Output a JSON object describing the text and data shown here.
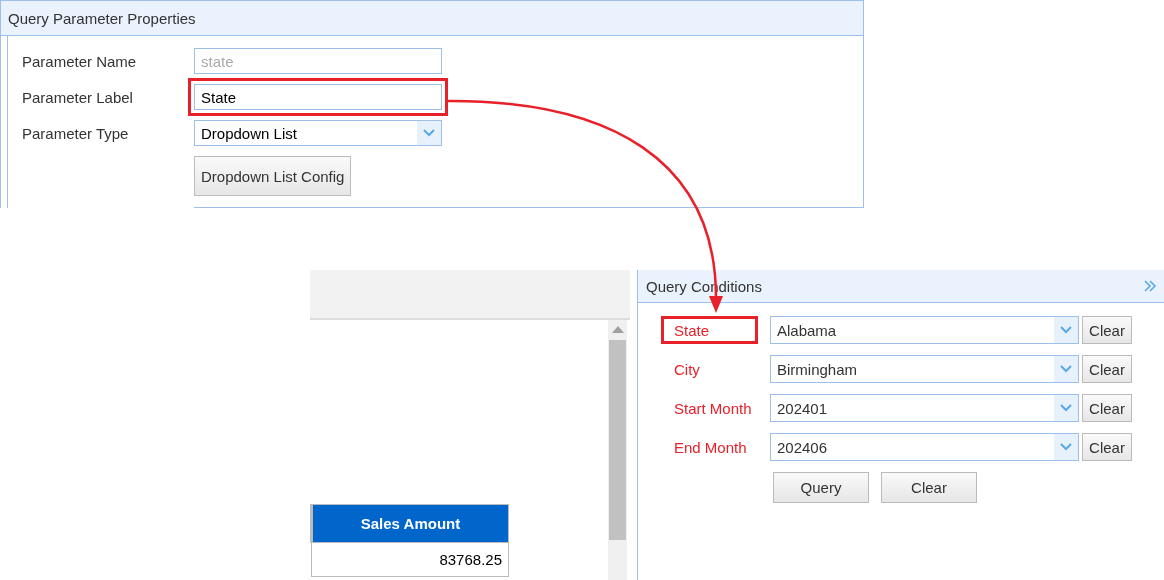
{
  "parameter_properties": {
    "title": "Query Parameter Properties",
    "fields": [
      {
        "label": "Parameter Name",
        "kind": "text",
        "value": "state",
        "disabled": true,
        "highlighted": false
      },
      {
        "label": "Parameter Label",
        "kind": "text",
        "value": "State",
        "disabled": false,
        "highlighted": true
      },
      {
        "label": "Parameter Type",
        "kind": "select",
        "value": "Dropdown List",
        "disabled": false,
        "highlighted": false
      }
    ],
    "config_button": "Dropdown List Config"
  },
  "report": {
    "table": {
      "columns": [
        "Sales Amount"
      ],
      "rows": [
        [
          "83768.25"
        ]
      ]
    }
  },
  "query_conditions": {
    "title": "Query Conditions",
    "conditions": [
      {
        "label": "State",
        "value": "Alabama",
        "clear": "Clear",
        "highlighted": true
      },
      {
        "label": "City",
        "value": "Birmingham",
        "clear": "Clear",
        "highlighted": false
      },
      {
        "label": "Start Month",
        "value": "202401",
        "clear": "Clear",
        "highlighted": false
      },
      {
        "label": "End Month",
        "value": "202406",
        "clear": "Clear",
        "highlighted": false
      }
    ],
    "buttons": [
      "Query",
      "Clear"
    ]
  }
}
